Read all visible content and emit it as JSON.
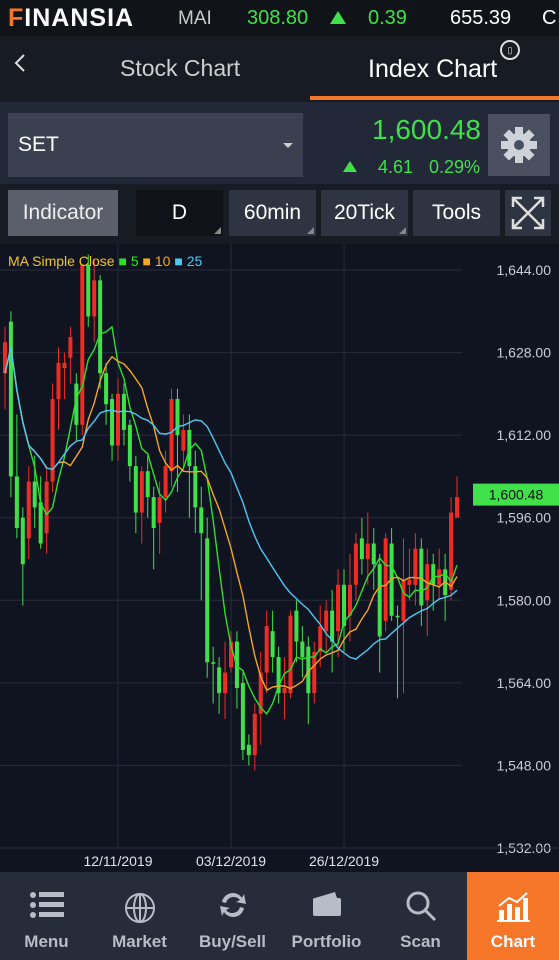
{
  "ticker": {
    "brand_prefix": "F",
    "brand_rest": "INANSIA",
    "index_name": "MAI",
    "index_value": "308.80",
    "index_change": "0.39",
    "volume": "655.39",
    "next_truncated": "C"
  },
  "tabs": {
    "back_icon": "chevron-left-icon",
    "stock_chart": "Stock Chart",
    "index_chart": "Index Chart"
  },
  "info": {
    "symbol": "SET",
    "price": "1,600.48",
    "change": "4.61",
    "change_pct": "0.29%"
  },
  "toolbar": {
    "indicator": "Indicator",
    "d": "D",
    "min60": "60min",
    "tick20": "20Tick",
    "tools": "Tools"
  },
  "chart_legend": {
    "label": "MA Simple Close",
    "ma5": "5",
    "ma10": "10",
    "ma25": "25"
  },
  "chart_axis": {
    "y_ticks": [
      "1,644.00",
      "1,628.00",
      "1,612.00",
      "1,596.00",
      "1,580.00",
      "1,564.00",
      "1,548.00",
      "1,532.00"
    ],
    "x_ticks": [
      "12/11/2019",
      "03/12/2019",
      "26/12/2019"
    ],
    "last_price_tag": "1,600.48"
  },
  "chart_data": {
    "type": "candlestick",
    "ylim": [
      1532,
      1644
    ],
    "candles": [
      [
        1630,
        1624,
        1633,
        1617
      ],
      [
        1604,
        1634,
        1636,
        1600
      ],
      [
        1594,
        1604,
        1616,
        1592
      ],
      [
        1587,
        1596,
        1598,
        1579
      ],
      [
        1603,
        1592,
        1606,
        1588
      ],
      [
        1598,
        1603,
        1608,
        1594
      ],
      [
        1591,
        1599,
        1604,
        1590
      ],
      [
        1603,
        1593,
        1606,
        1589
      ],
      [
        1619,
        1603,
        1622,
        1601
      ],
      [
        1626,
        1619,
        1629,
        1613
      ],
      [
        1626,
        1625,
        1628,
        1619
      ],
      [
        1631,
        1627,
        1633,
        1622
      ],
      [
        1614,
        1622,
        1624,
        1611
      ],
      [
        1645,
        1614,
        1645,
        1612
      ],
      [
        1635,
        1645,
        1647,
        1633
      ],
      [
        1642,
        1635,
        1646,
        1630
      ],
      [
        1624,
        1642,
        1643,
        1621
      ],
      [
        1618,
        1624,
        1626,
        1614
      ],
      [
        1610,
        1619,
        1620,
        1607
      ],
      [
        1620,
        1610,
        1623,
        1607
      ],
      [
        1613,
        1620,
        1622,
        1610
      ],
      [
        1606,
        1614,
        1615,
        1603
      ],
      [
        1597,
        1606,
        1608,
        1593
      ],
      [
        1605,
        1597,
        1606,
        1591
      ],
      [
        1600,
        1605,
        1608,
        1596
      ],
      [
        1594,
        1600,
        1602,
        1586
      ],
      [
        1600,
        1595,
        1603,
        1589
      ],
      [
        1606,
        1600,
        1609,
        1597
      ],
      [
        1619,
        1605,
        1621,
        1602
      ],
      [
        1612,
        1619,
        1621,
        1601
      ],
      [
        1613,
        1609,
        1616,
        1605
      ],
      [
        1606,
        1613,
        1616,
        1596
      ],
      [
        1598,
        1606,
        1609,
        1593
      ],
      [
        1593,
        1598,
        1602,
        1580
      ],
      [
        1568,
        1592,
        1596,
        1565
      ],
      [
        1568,
        1568,
        1571,
        1560
      ],
      [
        1562,
        1567,
        1569,
        1558
      ],
      [
        1566,
        1562,
        1572,
        1557
      ],
      [
        1572,
        1567,
        1574,
        1566
      ],
      [
        1563,
        1572,
        1574,
        1559
      ],
      [
        1551,
        1564,
        1566,
        1549
      ],
      [
        1550,
        1552,
        1554,
        1548
      ],
      [
        1558,
        1550,
        1560,
        1547
      ],
      [
        1566,
        1558,
        1570,
        1552
      ],
      [
        1575,
        1566,
        1578,
        1562
      ],
      [
        1569,
        1574,
        1578,
        1566
      ],
      [
        1562,
        1569,
        1571,
        1560
      ],
      [
        1563,
        1562,
        1569,
        1557
      ],
      [
        1577,
        1562,
        1578,
        1561
      ],
      [
        1572,
        1578,
        1580,
        1568
      ],
      [
        1569,
        1572,
        1575,
        1565
      ],
      [
        1562,
        1571,
        1573,
        1556
      ],
      [
        1570,
        1562,
        1572,
        1560
      ],
      [
        1575,
        1570,
        1579,
        1567
      ],
      [
        1578,
        1574,
        1580,
        1570
      ],
      [
        1572,
        1578,
        1582,
        1566
      ],
      [
        1583,
        1574,
        1586,
        1569
      ],
      [
        1575,
        1583,
        1586,
        1570
      ],
      [
        1583,
        1577,
        1589,
        1572
      ],
      [
        1591,
        1583,
        1593,
        1580
      ],
      [
        1588,
        1592,
        1596,
        1585
      ],
      [
        1591,
        1588,
        1597,
        1583
      ],
      [
        1587,
        1591,
        1594,
        1582
      ],
      [
        1573,
        1587,
        1589,
        1566
      ],
      [
        1592,
        1576,
        1593,
        1574
      ],
      [
        1577,
        1591,
        1594,
        1576
      ],
      [
        1577,
        1577,
        1579,
        1561
      ],
      [
        1584,
        1576,
        1592,
        1562
      ],
      [
        1584,
        1583,
        1590,
        1580
      ],
      [
        1590,
        1583,
        1593,
        1579
      ],
      [
        1579,
        1590,
        1592,
        1575
      ],
      [
        1587,
        1580,
        1590,
        1573
      ],
      [
        1583,
        1587,
        1589,
        1578
      ],
      [
        1586,
        1583,
        1590,
        1580
      ],
      [
        1581,
        1586,
        1589,
        1576
      ],
      [
        1597,
        1582,
        1600,
        1580
      ],
      [
        1600,
        1596,
        1604,
        1597
      ]
    ]
  },
  "nav": {
    "items": [
      "Menu",
      "Market",
      "Buy/Sell",
      "Portfolio",
      "Scan",
      "Chart"
    ],
    "active": "Chart"
  },
  "colors": {
    "accent": "#f7772a",
    "up": "#3fe04a",
    "down": "#ef2b24",
    "ma5": "#2ee02e",
    "ma10": "#f5a623",
    "ma25": "#4fc7f2"
  }
}
